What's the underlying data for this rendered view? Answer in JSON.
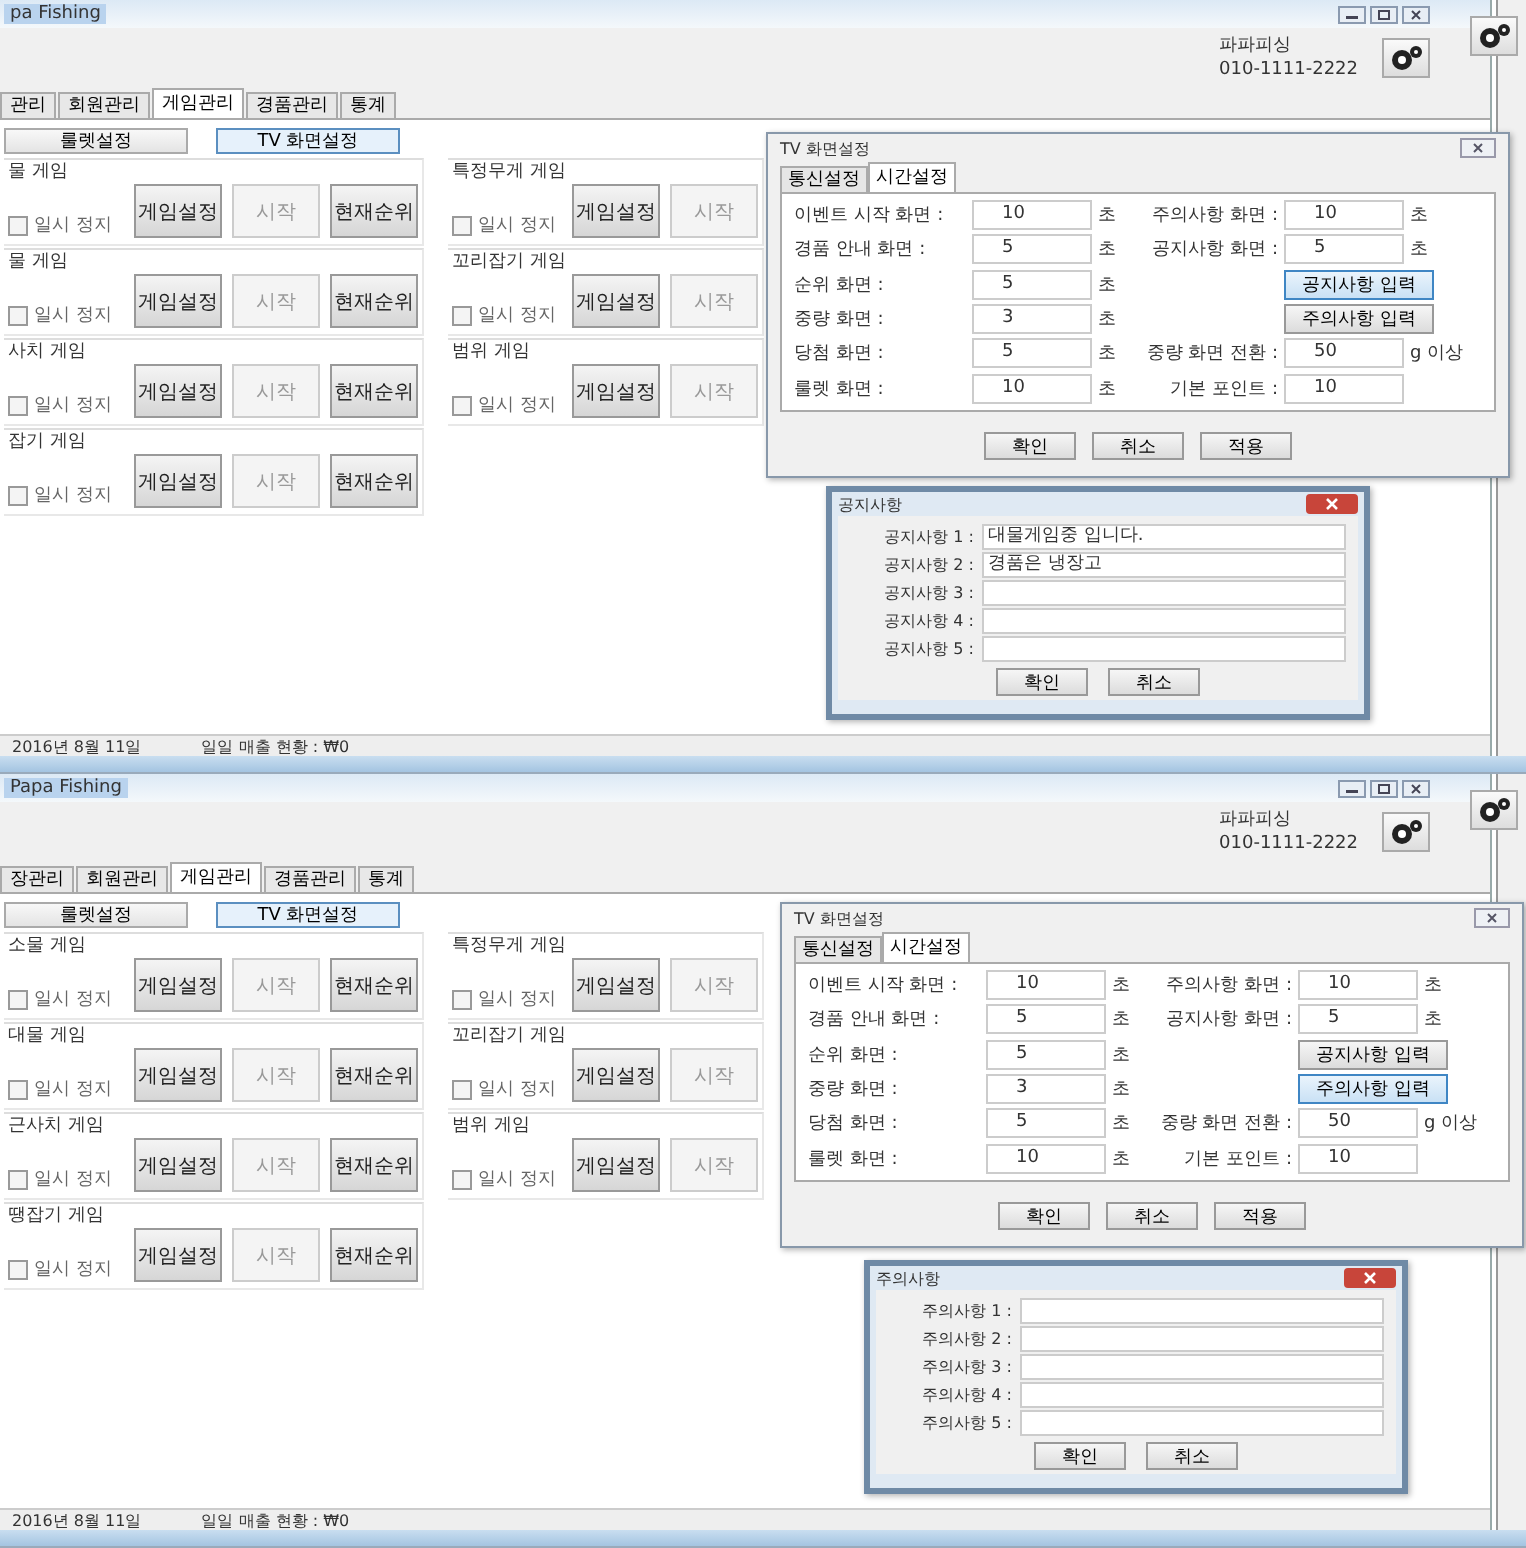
{
  "screens": [
    {
      "window": {
        "title": "pa Fishing"
      },
      "company": {
        "name": "파파피싱",
        "phone": "010-1111-2222"
      },
      "tabs": [
        {
          "label": "관리",
          "selected": false
        },
        {
          "label": "회원관리",
          "selected": false
        },
        {
          "label": "게임관리",
          "selected": true
        },
        {
          "label": "경품관리",
          "selected": false
        },
        {
          "label": "통계",
          "selected": false
        }
      ],
      "subtabs": [
        {
          "label": "룰렛설정",
          "selected": false
        },
        {
          "label": "TV 화면설정",
          "selected": true
        }
      ],
      "left_games": [
        {
          "title": "물 게임",
          "paused": false,
          "pause_label": "일시 정지",
          "buttons": [
            {
              "label": "게임설정",
              "disabled": false
            },
            {
              "label": "시작",
              "disabled": true
            },
            {
              "label": "현재순위",
              "disabled": false
            }
          ]
        },
        {
          "title": "물 게임",
          "paused": false,
          "pause_label": "일시 정지",
          "buttons": [
            {
              "label": "게임설정",
              "disabled": false
            },
            {
              "label": "시작",
              "disabled": true
            },
            {
              "label": "현재순위",
              "disabled": false
            }
          ]
        },
        {
          "title": "사치 게임",
          "paused": false,
          "pause_label": "일시 정지",
          "buttons": [
            {
              "label": "게임설정",
              "disabled": false
            },
            {
              "label": "시작",
              "disabled": true
            },
            {
              "label": "현재순위",
              "disabled": false
            }
          ]
        },
        {
          "title": "잡기 게임",
          "paused": false,
          "pause_label": "일시 정지",
          "buttons": [
            {
              "label": "게임설정",
              "disabled": false
            },
            {
              "label": "시작",
              "disabled": true
            },
            {
              "label": "현재순위",
              "disabled": false
            }
          ]
        }
      ],
      "right_games": [
        {
          "title": "특정무게 게임",
          "paused": false,
          "pause_label": "일시 정지",
          "buttons": [
            {
              "label": "게임설정",
              "disabled": false
            },
            {
              "label": "시작",
              "disabled": true
            }
          ]
        },
        {
          "title": "꼬리잡기 게임",
          "paused": false,
          "pause_label": "일시 정지",
          "buttons": [
            {
              "label": "게임설정",
              "disabled": false
            },
            {
              "label": "시작",
              "disabled": true
            }
          ]
        },
        {
          "title": "범위 게임",
          "paused": false,
          "pause_label": "일시 정지",
          "buttons": [
            {
              "label": "게임설정",
              "disabled": false
            },
            {
              "label": "시작",
              "disabled": true
            }
          ]
        }
      ],
      "status_bar": {
        "date": "2016년 8월 11일",
        "sales": "일일 매출 현황 : ₩0"
      },
      "tv_dialog": {
        "title": "TV 화면설정",
        "tabs": [
          {
            "label": "통신설정",
            "selected": false
          },
          {
            "label": "시간설정",
            "selected": true
          }
        ],
        "left_fields": [
          {
            "label": "이벤트 시작 화면 :",
            "value": "10",
            "unit": "초"
          },
          {
            "label": "경품 안내 화면 :",
            "value": "5",
            "unit": "초"
          },
          {
            "label": "순위 화면 :",
            "value": "5",
            "unit": "초"
          },
          {
            "label": "중량 화면 :",
            "value": "3",
            "unit": "초"
          },
          {
            "label": "당첨 화면 :",
            "value": "5",
            "unit": "초"
          },
          {
            "label": "룰렛 화면 :",
            "value": "10",
            "unit": "초"
          }
        ],
        "right_items": [
          {
            "kind": "field",
            "label": "주의사항 화면 :",
            "value": "10",
            "unit": "초"
          },
          {
            "kind": "field",
            "label": "공지사항 화면 :",
            "value": "5",
            "unit": "초"
          },
          {
            "kind": "button",
            "label": "공지사항 입력",
            "focused": true
          },
          {
            "kind": "button",
            "label": "주의사항 입력",
            "focused": false
          },
          {
            "kind": "field",
            "label": "중량 화면 전환 :",
            "value": "50",
            "unit": "g 이상"
          },
          {
            "kind": "field",
            "label": "기본 포인트 :",
            "value": "10"
          }
        ],
        "buttons": [
          "확인",
          "취소",
          "적용"
        ]
      },
      "notice_dialog": {
        "title": "공지사항",
        "rows": [
          {
            "label": "공지사항 1 :",
            "value": "대물게임중 입니다."
          },
          {
            "label": "공지사항 2 :",
            "value": "경품은 냉장고"
          },
          {
            "label": "공지사항 3 :"
          },
          {
            "label": "공지사항 4 :"
          },
          {
            "label": "공지사항 5 :"
          }
        ],
        "buttons": [
          "확인",
          "취소"
        ]
      }
    },
    {
      "window": {
        "title": "Papa Fishing"
      },
      "company": {
        "name": "파파피싱",
        "phone": "010-1111-2222"
      },
      "tabs": [
        {
          "label": "장관리",
          "selected": false
        },
        {
          "label": "회원관리",
          "selected": false
        },
        {
          "label": "게임관리",
          "selected": true
        },
        {
          "label": "경품관리",
          "selected": false
        },
        {
          "label": "통계",
          "selected": false
        }
      ],
      "subtabs": [
        {
          "label": "룰렛설정",
          "selected": false
        },
        {
          "label": "TV 화면설정",
          "selected": true
        }
      ],
      "left_games": [
        {
          "title": "소물 게임",
          "paused": false,
          "pause_label": "일시 정지",
          "buttons": [
            {
              "label": "게임설정",
              "disabled": false
            },
            {
              "label": "시작",
              "disabled": true
            },
            {
              "label": "현재순위",
              "disabled": false
            }
          ]
        },
        {
          "title": "대물 게임",
          "paused": false,
          "pause_label": "일시 정지",
          "buttons": [
            {
              "label": "게임설정",
              "disabled": false
            },
            {
              "label": "시작",
              "disabled": true
            },
            {
              "label": "현재순위",
              "disabled": false
            }
          ]
        },
        {
          "title": "근사치 게임",
          "paused": false,
          "pause_label": "일시 정지",
          "buttons": [
            {
              "label": "게임설정",
              "disabled": false
            },
            {
              "label": "시작",
              "disabled": true
            },
            {
              "label": "현재순위",
              "disabled": false
            }
          ]
        },
        {
          "title": "땡잡기 게임",
          "paused": false,
          "pause_label": "일시 정지",
          "buttons": [
            {
              "label": "게임설정",
              "disabled": false
            },
            {
              "label": "시작",
              "disabled": true
            },
            {
              "label": "현재순위",
              "disabled": false
            }
          ]
        }
      ],
      "right_games": [
        {
          "title": "특정무게 게임",
          "paused": false,
          "pause_label": "일시 정지",
          "buttons": [
            {
              "label": "게임설정",
              "disabled": false
            },
            {
              "label": "시작",
              "disabled": true
            }
          ]
        },
        {
          "title": "꼬리잡기 게임",
          "paused": false,
          "pause_label": "일시 정지",
          "buttons": [
            {
              "label": "게임설정",
              "disabled": false
            },
            {
              "label": "시작",
              "disabled": true
            }
          ]
        },
        {
          "title": "범위 게임",
          "paused": false,
          "pause_label": "일시 정지",
          "buttons": [
            {
              "label": "게임설정",
              "disabled": false
            },
            {
              "label": "시작",
              "disabled": true
            }
          ]
        }
      ],
      "status_bar": {
        "date": "2016년 8월 11일",
        "sales": "일일 매출 현황 : ₩0"
      },
      "tv_dialog": {
        "title": "TV 화면설정",
        "tabs": [
          {
            "label": "통신설정",
            "selected": false
          },
          {
            "label": "시간설정",
            "selected": true
          }
        ],
        "left_fields": [
          {
            "label": "이벤트 시작 화면 :",
            "value": "10",
            "unit": "초"
          },
          {
            "label": "경품 안내 화면 :",
            "value": "5",
            "unit": "초"
          },
          {
            "label": "순위 화면 :",
            "value": "5",
            "unit": "초"
          },
          {
            "label": "중량 화면 :",
            "value": "3",
            "unit": "초"
          },
          {
            "label": "당첨 화면 :",
            "value": "5",
            "unit": "초"
          },
          {
            "label": "룰렛 화면 :",
            "value": "10",
            "unit": "초"
          }
        ],
        "right_items": [
          {
            "kind": "field",
            "label": "주의사항 화면 :",
            "value": "10",
            "unit": "초"
          },
          {
            "kind": "field",
            "label": "공지사항 화면 :",
            "value": "5",
            "unit": "초"
          },
          {
            "kind": "button",
            "label": "공지사항 입력",
            "focused": false
          },
          {
            "kind": "button",
            "label": "주의사항 입력",
            "focused": true
          },
          {
            "kind": "field",
            "label": "중량 화면 전환 :",
            "value": "50",
            "unit": "g 이상"
          },
          {
            "kind": "field",
            "label": "기본 포인트 :",
            "value": "10"
          }
        ],
        "buttons": [
          "확인",
          "취소",
          "적용"
        ]
      },
      "notice_dialog": {
        "title": "주의사항",
        "rows": [
          {
            "label": "주의사항 1 :"
          },
          {
            "label": "주의사항 2 :"
          },
          {
            "label": "주의사항 3 :"
          },
          {
            "label": "주의사항 4 :"
          },
          {
            "label": "주의사항 5 :"
          }
        ],
        "buttons": [
          "확인",
          "취소"
        ]
      }
    }
  ]
}
